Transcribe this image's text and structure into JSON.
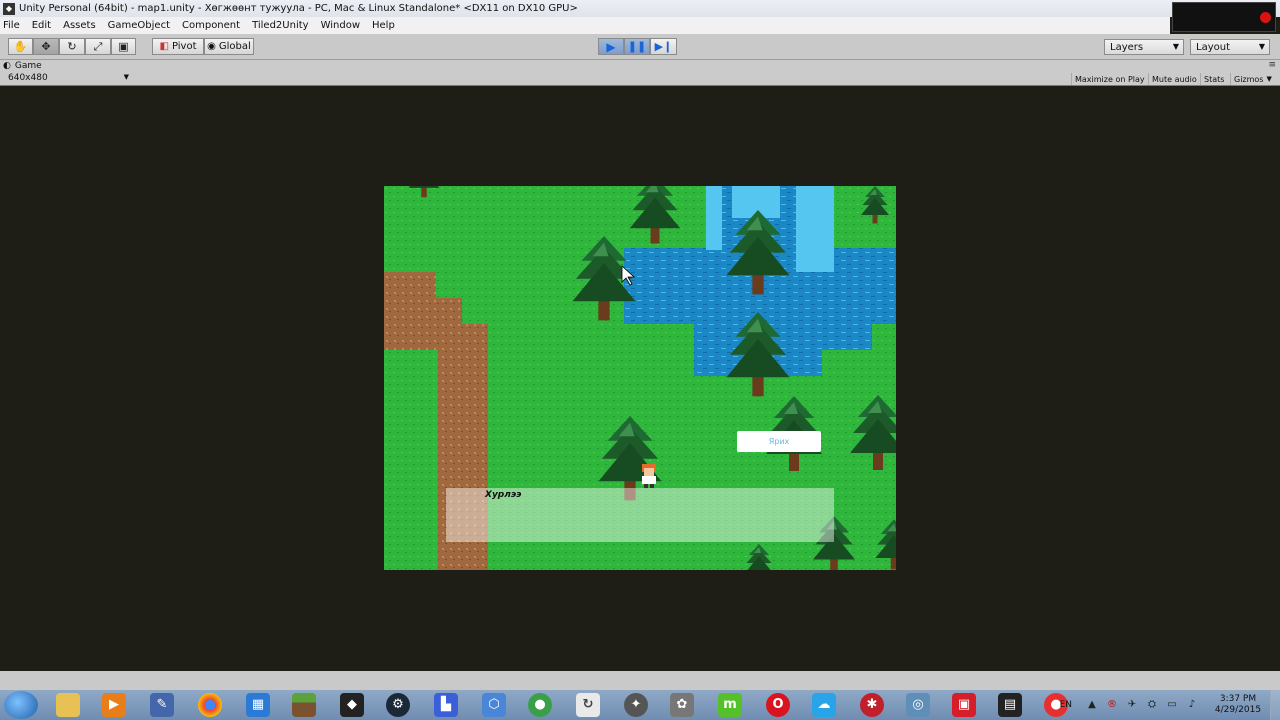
{
  "window": {
    "title": "Unity Personal (64bit) - map1.unity - Хөгжөөнт тужуула - PC, Mac & Linux Standalone* <DX11 on DX10 GPU>"
  },
  "menu": [
    "File",
    "Edit",
    "Assets",
    "GameObject",
    "Component",
    "Tiled2Unity",
    "Window",
    "Help"
  ],
  "toolbar": {
    "pivot": "Pivot",
    "global": "Global",
    "layers": "Layers",
    "layout": "Layout"
  },
  "game_tab": {
    "label": "Game",
    "resolution": "640x480",
    "maximize": "Maximize on Play",
    "mute": "Mute audio",
    "stats": "Stats",
    "gizmos": "Gizmos"
  },
  "game": {
    "dialog_name": "Хурлээ",
    "button_label": "Ярих"
  },
  "taskbar": {
    "lang": "EN",
    "time": "3:37 PM",
    "date": "4/29/2015"
  },
  "colors": {
    "grass": "#2eb73c",
    "water": "#1a87c7",
    "dirt": "#a0683e",
    "tree": "#1d5a2a",
    "toolbar": "#c9c9c9",
    "bg": "#1e1d16"
  }
}
